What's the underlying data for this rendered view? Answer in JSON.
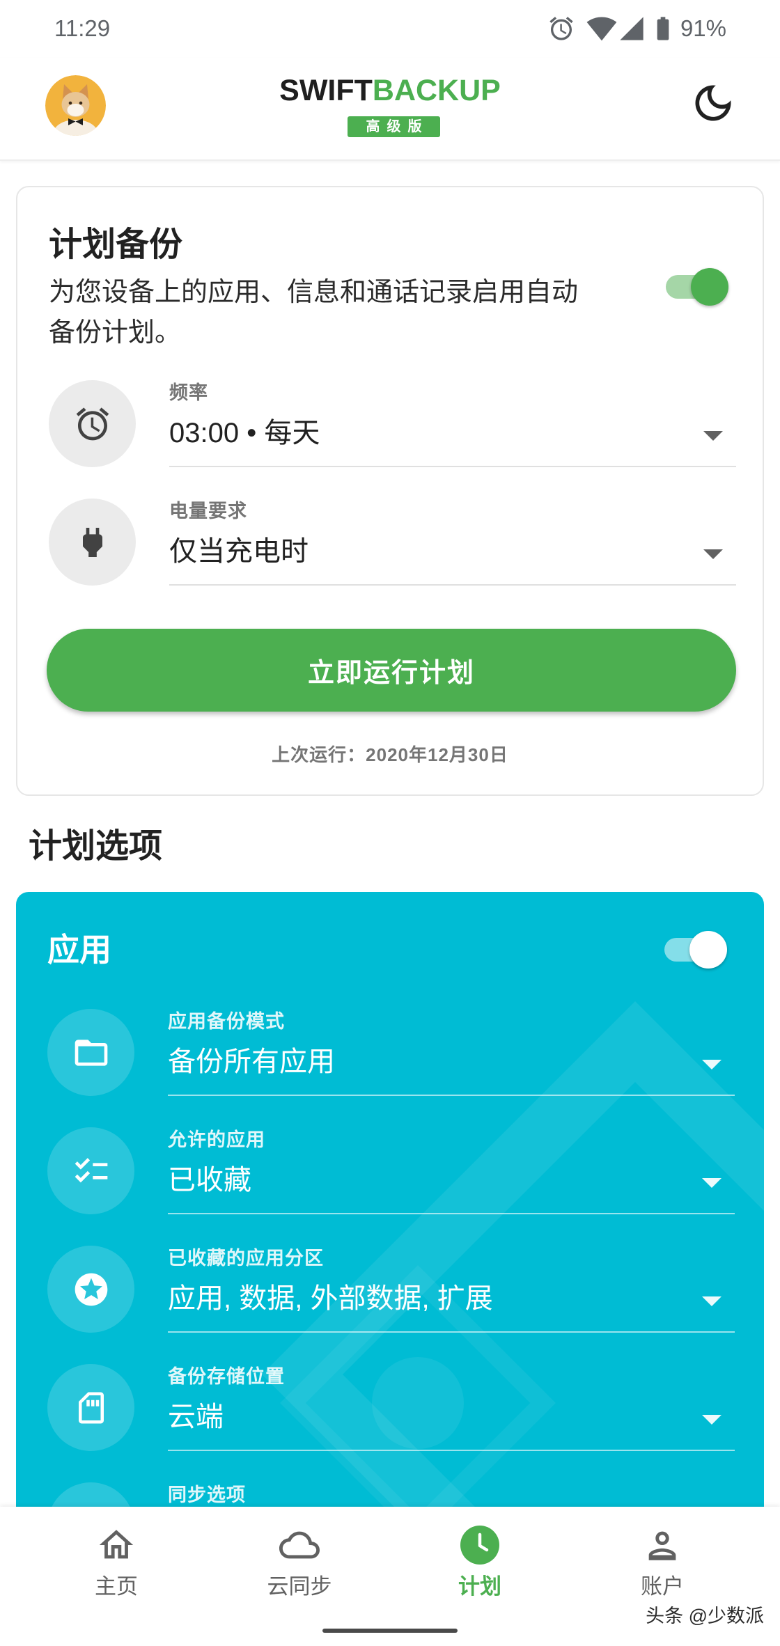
{
  "status_bar": {
    "time": "11:29",
    "battery_level": "91%",
    "icons": [
      "alarm-icon",
      "wifi-icon",
      "cell-signal-icon",
      "battery-icon"
    ]
  },
  "header": {
    "logo": {
      "primary": "SWIFT",
      "accent": "BACKUP"
    },
    "edition_badge": "高级版",
    "theme_icon": "moon-icon"
  },
  "schedule_card": {
    "title": "计划备份",
    "description": "为您设备上的应用、信息和通话记录启用自动备份计划。",
    "toggle_on": true,
    "settings": [
      {
        "icon": "alarm-clock-icon",
        "label": "频率",
        "value": "03:00 • 每天"
      },
      {
        "icon": "plug-icon",
        "label": "电量要求",
        "value": "仅当充电时"
      }
    ],
    "run_now_button": "立即运行计划",
    "last_run": "上次运行：2020年12月30日"
  },
  "schedule_options": {
    "heading": "计划选项",
    "apps": {
      "title": "应用",
      "toggle_on": true,
      "settings": [
        {
          "icon": "folder-icon",
          "label": "应用备份模式",
          "value": "备份所有应用"
        },
        {
          "icon": "checklist-icon",
          "label": "允许的应用",
          "value": "已收藏"
        },
        {
          "icon": "star-circle-icon",
          "label": "已收藏的应用分区",
          "value": "应用, 数据, 外部数据, 扩展"
        },
        {
          "icon": "sd-card-icon",
          "label": "备份存储位置",
          "value": "云端"
        },
        {
          "icon": "sync-icon",
          "label": "同步选项"
        }
      ]
    }
  },
  "bottom_nav": {
    "items": [
      {
        "label": "主页",
        "icon": "home-icon",
        "active": false
      },
      {
        "label": "云同步",
        "icon": "cloud-icon",
        "active": false
      },
      {
        "label": "计划",
        "icon": "schedule-clock-icon",
        "active": true
      },
      {
        "label": "账户",
        "icon": "person-icon",
        "active": false
      }
    ]
  },
  "watermark": "头条 @少数派",
  "colors": {
    "brand_green": "#4CAF50",
    "toggle_track_green": "#A5D6A7",
    "options_card_teal": "#00BCD4",
    "toggle_track_teal": "#84DEE9",
    "text_primary": "#212121",
    "text_secondary": "#757575",
    "nav_inactive": "#616161"
  }
}
